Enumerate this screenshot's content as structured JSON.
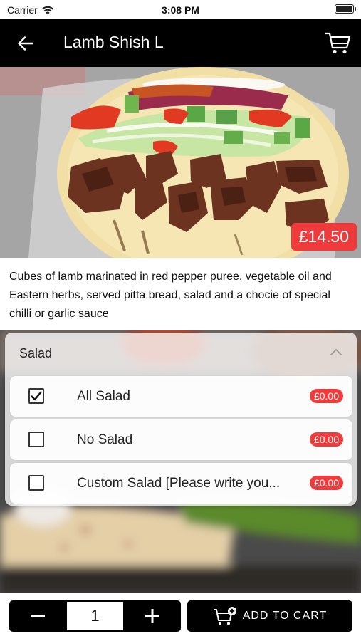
{
  "status_bar": {
    "carrier": "Carrier",
    "time": "3:08 PM"
  },
  "header": {
    "title": "Lamb Shish L",
    "back_icon": "arrow-left-icon",
    "cart_icon": "cart-icon"
  },
  "product": {
    "price": "£14.50",
    "description": "Cubes of lamb marinated in red pepper puree, vegetable oil and Eastern herbs, served pitta bread, salad and a chocie of special chilli or garlic sauce"
  },
  "options_group": {
    "title": "Salad",
    "expanded": true,
    "items": [
      {
        "label": "All Salad",
        "price": "£0.00",
        "checked": true
      },
      {
        "label": "No Salad",
        "price": "£0.00",
        "checked": false
      },
      {
        "label": "Custom Salad [Please write you...",
        "price": "£0.00",
        "checked": false
      }
    ]
  },
  "footer": {
    "quantity": "1",
    "add_to_cart_label": "ADD TO CART"
  },
  "colors": {
    "accent": "#ef3b3b",
    "bar": "#000000"
  }
}
